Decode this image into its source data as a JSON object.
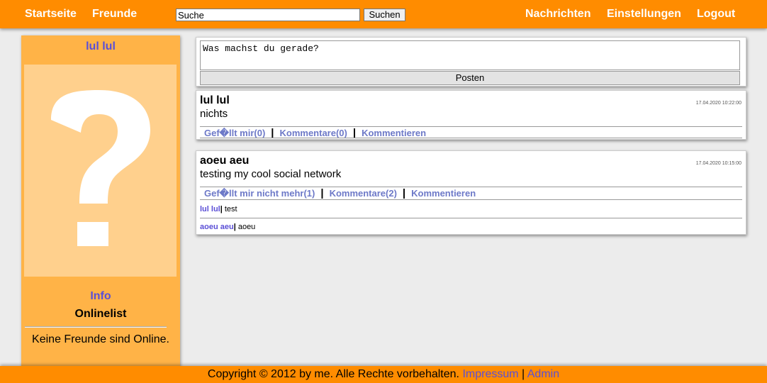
{
  "nav": {
    "home": "Startseite",
    "friends": "Freunde",
    "messages": "Nachrichten",
    "settings": "Einstellungen",
    "logout": "Logout"
  },
  "search": {
    "value": "Suche",
    "button": "Suchen"
  },
  "sidebar": {
    "profile_name": "lul lul",
    "avatar_glyph": "?",
    "info": "Info",
    "onlinelist_title": "Onlinelist",
    "no_friends": "Keine Freunde sind Online."
  },
  "compose": {
    "text": "Was machst du gerade?",
    "button": "Posten"
  },
  "posts": [
    {
      "author": "lul lul",
      "time": "17.04.2020 10:22:00",
      "body": "nichts",
      "like": "Gef�llt mir(0)",
      "comments": "Kommentare(0)",
      "comment_action": "Kommentieren",
      "comment_list": []
    },
    {
      "author": "aoeu aeu",
      "time": "17.04.2020 10:15:00",
      "body": "testing my cool social network",
      "like": "Gef�llt mir nicht mehr(1)",
      "comments": "Kommentare(2)",
      "comment_action": "Kommentieren",
      "comment_list": [
        {
          "author": "lul lul",
          "text": "test"
        },
        {
          "author": "aoeu aeu",
          "text": "aoeu"
        }
      ]
    }
  ],
  "footer": {
    "copyright": "Copyright © 2012 by me. Alle Rechte vorbehalten.",
    "impressum": "Impressum",
    "separator": "|",
    "admin": "Admin"
  },
  "colors": {
    "accent": "#ff8c00",
    "sidebar": "#ffb347",
    "link": "#5b4fd6",
    "action_link": "#6d79c8"
  }
}
